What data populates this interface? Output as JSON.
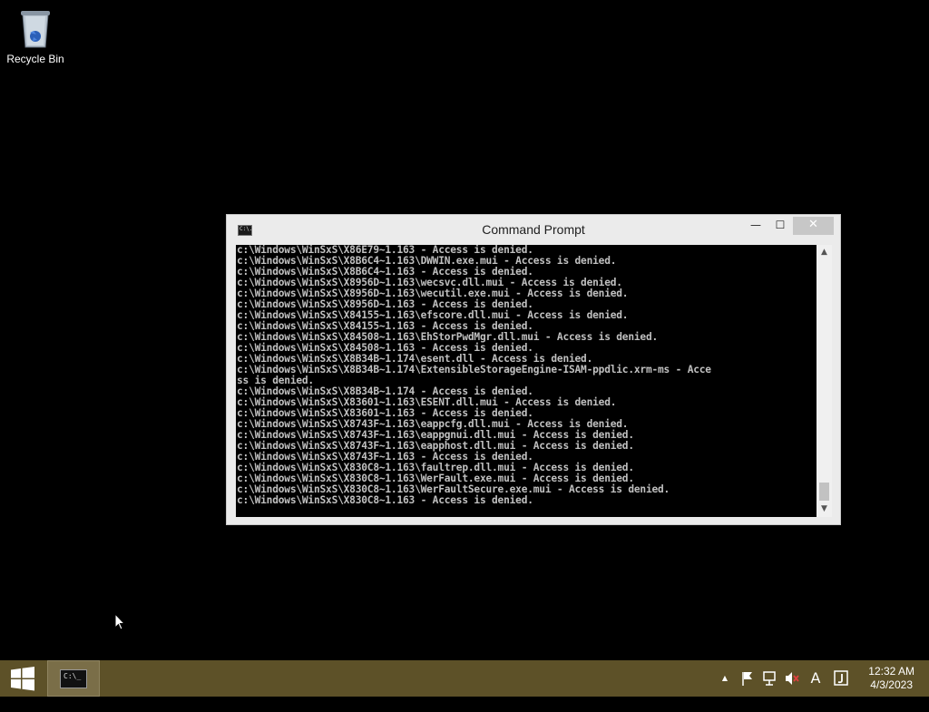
{
  "desktop": {
    "recycle_bin_label": "Recycle Bin"
  },
  "window": {
    "title": "Command Prompt",
    "icon_text": "C:\\.",
    "minimize_symbol": "—",
    "maximize_symbol": "☐",
    "close_symbol": "✕"
  },
  "console": {
    "text": "c:\\Windows\\WinSxS\\X86E79~1.163 - Access is denied.\nc:\\Windows\\WinSxS\\X8B6C4~1.163\\DWWIN.exe.mui - Access is denied.\nc:\\Windows\\WinSxS\\X8B6C4~1.163 - Access is denied.\nc:\\Windows\\WinSxS\\X8956D~1.163\\wecsvc.dll.mui - Access is denied.\nc:\\Windows\\WinSxS\\X8956D~1.163\\wecutil.exe.mui - Access is denied.\nc:\\Windows\\WinSxS\\X8956D~1.163 - Access is denied.\nc:\\Windows\\WinSxS\\X84155~1.163\\efscore.dll.mui - Access is denied.\nc:\\Windows\\WinSxS\\X84155~1.163 - Access is denied.\nc:\\Windows\\WinSxS\\X84508~1.163\\EhStorPwdMgr.dll.mui - Access is denied.\nc:\\Windows\\WinSxS\\X84508~1.163 - Access is denied.\nc:\\Windows\\WinSxS\\X8B34B~1.174\\esent.dll - Access is denied.\nc:\\Windows\\WinSxS\\X8B34B~1.174\\ExtensibleStorageEngine-ISAM-ppdlic.xrm-ms - Acce\nss is denied.\nc:\\Windows\\WinSxS\\X8B34B~1.174 - Access is denied.\nc:\\Windows\\WinSxS\\X83601~1.163\\ESENT.dll.mui - Access is denied.\nc:\\Windows\\WinSxS\\X83601~1.163 - Access is denied.\nc:\\Windows\\WinSxS\\X8743F~1.163\\eappcfg.dll.mui - Access is denied.\nc:\\Windows\\WinSxS\\X8743F~1.163\\eappgnui.dll.mui - Access is denied.\nc:\\Windows\\WinSxS\\X8743F~1.163\\eapphost.dll.mui - Access is denied.\nc:\\Windows\\WinSxS\\X8743F~1.163 - Access is denied.\nc:\\Windows\\WinSxS\\X830C8~1.163\\faultrep.dll.mui - Access is denied.\nc:\\Windows\\WinSxS\\X830C8~1.163\\WerFault.exe.mui - Access is denied.\nc:\\Windows\\WinSxS\\X830C8~1.163\\WerFaultSecure.exe.mui - Access is denied.\nc:\\Windows\\WinSxS\\X830C8~1.163 - Access is denied."
  },
  "taskbar": {
    "task_icon_text": "C:\\_",
    "tray": {
      "show_hidden_symbol": "▲",
      "ime_label": "A"
    },
    "clock": {
      "time": "12:32 AM",
      "date": "4/3/2023"
    }
  },
  "colors": {
    "taskbar": "#5d5128",
    "desktop": "#000000",
    "window_frame": "#ebebeb"
  }
}
